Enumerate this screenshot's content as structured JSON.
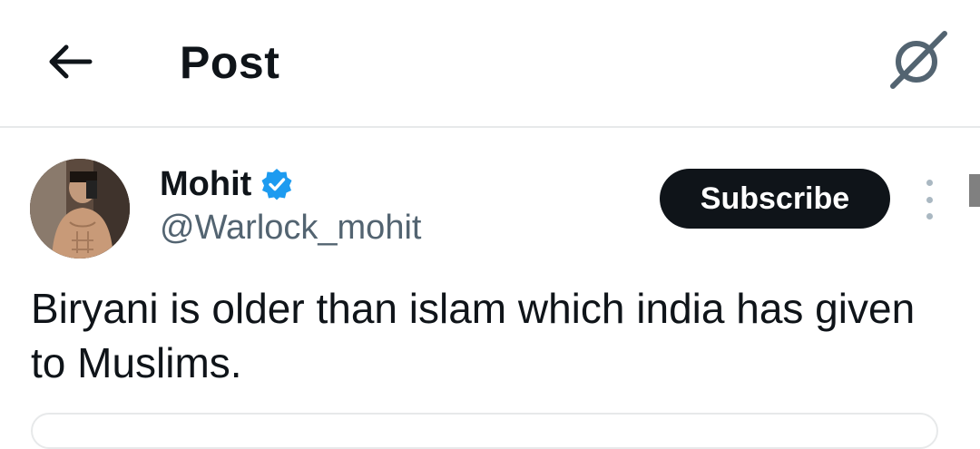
{
  "header": {
    "title": "Post"
  },
  "author": {
    "name": "Mohit",
    "handle": "@Warlock_mohit",
    "verified": true
  },
  "actions": {
    "subscribe_label": "Subscribe"
  },
  "tweet": {
    "text": "Biryani is older than islam which india has given to Muslims."
  },
  "colors": {
    "text_primary": "#0f1419",
    "text_secondary": "#536471",
    "verified_blue": "#1d9bf0",
    "button_dark": "#0f1419",
    "divider": "#e7e9ea"
  },
  "icons": {
    "back": "arrow-left-icon",
    "grok": "grok-slash-icon",
    "verified": "verified-badge-icon",
    "more": "more-vertical-icon"
  }
}
